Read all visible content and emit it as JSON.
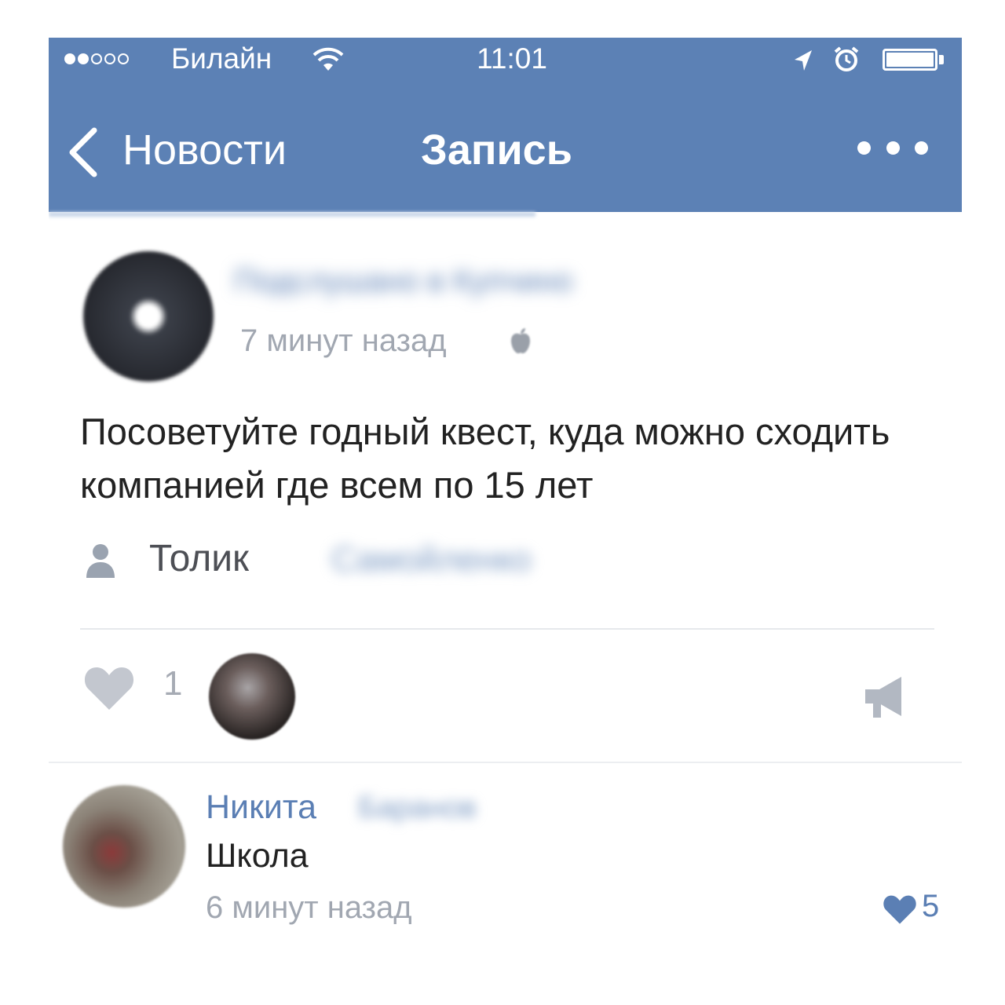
{
  "status_bar": {
    "carrier": "Билайн",
    "time": "11:01",
    "signal_filled_dots": 2,
    "signal_total_dots": 5
  },
  "nav": {
    "back_label": "Новости",
    "title": "Запись",
    "more_icon": "more-dots-icon"
  },
  "post": {
    "author": "Подслушано в Купчино",
    "time": "7 минут назад",
    "text": "Посоветуйте годный квест, куда можно сходить компанией где всем по 15 лет",
    "signer_first_name": "Толик",
    "signer_last_name": "Самойленко",
    "likes": "1"
  },
  "comment": {
    "author_first_name": "Никита",
    "author_last_name": "Баранов",
    "text": "Школа",
    "time": "6 минут назад",
    "likes": "5"
  },
  "colors": {
    "header_bg": "#5c81b5",
    "link": "#5b7fb4",
    "muted": "#a1a7b1",
    "text": "#222222"
  }
}
